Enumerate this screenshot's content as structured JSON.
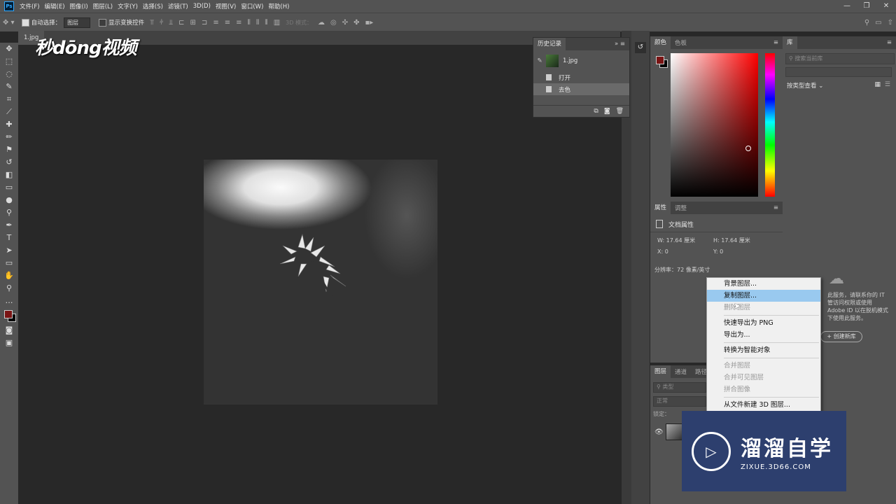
{
  "menubar": {
    "items": [
      "文件(F)",
      "编辑(E)",
      "图像(I)",
      "图层(L)",
      "文字(Y)",
      "选择(S)",
      "滤镜(T)",
      "3D(D)",
      "视图(V)",
      "窗口(W)",
      "帮助(H)"
    ],
    "app_icon": "Ps"
  },
  "options": {
    "auto_select_label": "自动选择：",
    "auto_select_value": "图层",
    "show_transform_label": "显示变换控件",
    "mode_3d_label": "3D 模式："
  },
  "document": {
    "tab_label": "1.jpg"
  },
  "watermark": {
    "logo_text": "秒dōng视频"
  },
  "history": {
    "title": "历史记录",
    "snapshot_label": "1.jpg",
    "items": [
      "打开",
      "去色"
    ]
  },
  "color_panel": {
    "tabs": [
      "颜色",
      "色板"
    ]
  },
  "properties_panel": {
    "tabs": [
      "属性",
      "调整"
    ],
    "section": "文档属性",
    "w": "W:  17.64 厘米",
    "h": "H:  17.64 厘米",
    "x": "X:  0",
    "y": "Y:  0",
    "resolution": "分辨率：72 像素/英寸"
  },
  "layers_panel": {
    "tabs": [
      "图层",
      "通道",
      "路径"
    ],
    "kind_placeholder": "类型",
    "blend_mode": "正常",
    "lock_label": "锁定："
  },
  "library_panel": {
    "title": "库",
    "search_placeholder": "搜索当前库",
    "view_by": "按类型查看",
    "message": "此服务，请联系你的 IT 管访问权限或使用 Adobe ID 以在脱机模式下使用此服务。",
    "create_button": "+ 创建新库"
  },
  "context_menu": {
    "items": [
      {
        "label": "背景图层...",
        "state": "normal"
      },
      {
        "label": "复制图层...",
        "state": "highlight"
      },
      {
        "label": "删除图层",
        "state": "disabled"
      },
      {
        "sep": true
      },
      {
        "label": "快速导出为 PNG",
        "state": "normal"
      },
      {
        "label": "导出为...",
        "state": "normal"
      },
      {
        "sep": true
      },
      {
        "label": "转换为智能对象",
        "state": "normal"
      },
      {
        "sep": true
      },
      {
        "label": "合并图层",
        "state": "disabled"
      },
      {
        "label": "合并可见图层",
        "state": "disabled"
      },
      {
        "label": "拼合图像",
        "state": "disabled"
      },
      {
        "sep": true
      },
      {
        "label": "从文件新建 3D 图层...",
        "state": "normal"
      }
    ]
  },
  "brand": {
    "name": "溜溜自学",
    "url": "ZIXUE.3D66.COM"
  },
  "colors": {
    "foreground": "#7a1414",
    "background": "#000000",
    "highlight": "#99c9ef"
  }
}
